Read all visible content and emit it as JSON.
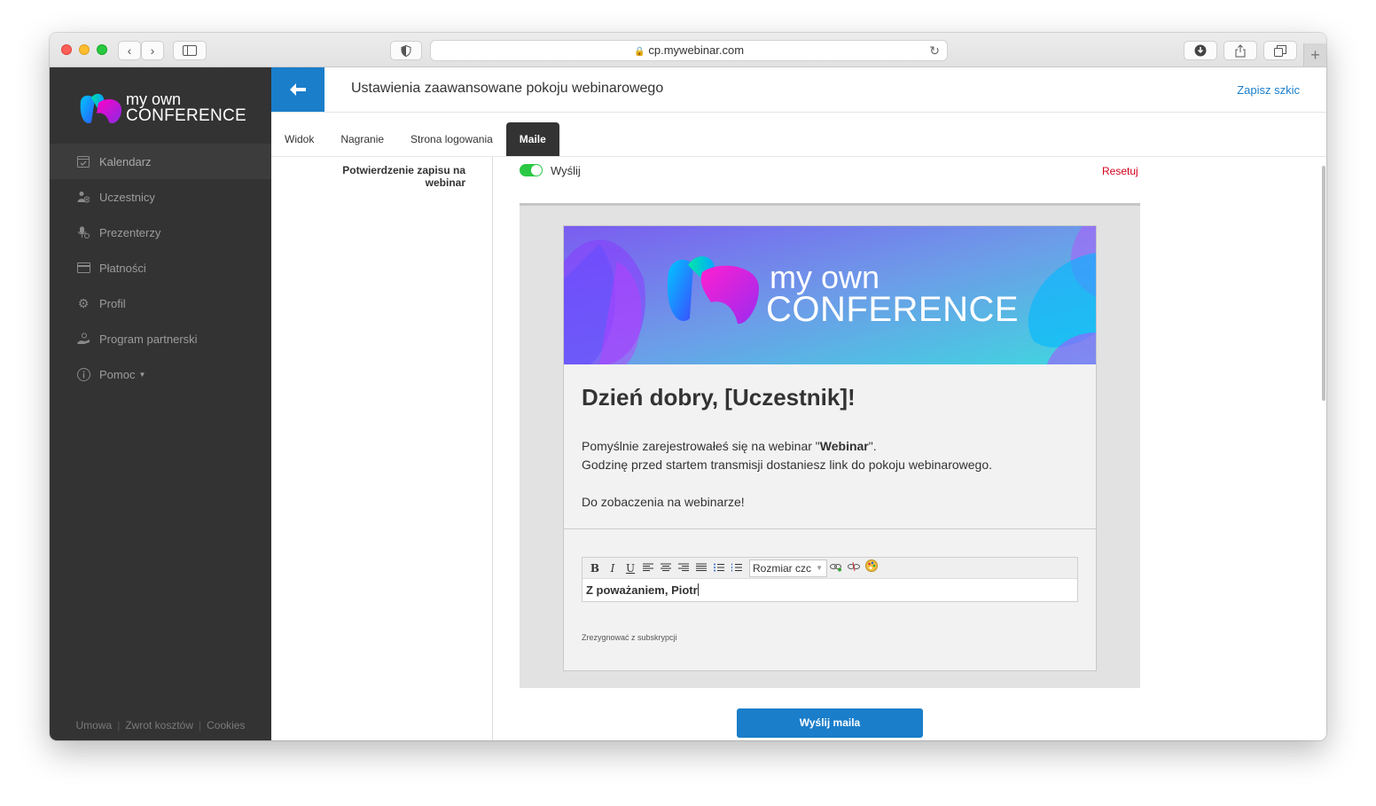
{
  "browser": {
    "url": "cp.mywebinar.com",
    "new_tab": "+"
  },
  "sidebar": {
    "logo_line1": "my own",
    "logo_line2": "CONFERENCE",
    "items": [
      {
        "label": "Kalendarz",
        "icon": "calendar-icon"
      },
      {
        "label": "Uczestnicy",
        "icon": "participants-icon"
      },
      {
        "label": "Prezenterzy",
        "icon": "presenters-icon"
      },
      {
        "label": "Płatności",
        "icon": "card-icon"
      },
      {
        "label": "Profil",
        "icon": "gear-icon"
      },
      {
        "label": "Program partnerski",
        "icon": "partner-icon"
      },
      {
        "label": "Pomoc",
        "icon": "info-icon"
      }
    ],
    "footer": [
      "Umowa",
      "Zwrot kosztów",
      "Cookies"
    ]
  },
  "header": {
    "title": "Ustawienia zaawansowane pokoju webinarowego",
    "save_draft": "Zapisz szkic"
  },
  "tabs": [
    "Widok",
    "Nagranie",
    "Strona logowania",
    "Maile"
  ],
  "active_tab": "Maile",
  "section": {
    "label": "Potwierdzenie zapisu na webinar",
    "toggle_label": "Wyślij",
    "toggle_on": true,
    "reset": "Resetuj"
  },
  "email": {
    "banner_line1": "my own",
    "banner_line2": "CONFERENCE",
    "heading": "Dzień dobry, [Uczestnik]!",
    "body_line1_prefix": "Pomyślnie zarejestrowałeś się na webinar \"",
    "body_line1_bold": "Webinar",
    "body_line1_suffix": "\".",
    "body_line2": "Godzinę przed startem transmisji dostaniesz link do pokoju webinarowego.",
    "body_line3": "Do zobaczenia na webinarze!",
    "editor_font_size_placeholder": "Rozmiar czc",
    "editor_text": "Z poważaniem, Piotr",
    "unsubscribe": "Zrezygnować z subskrypcji"
  },
  "send_button": "Wyślij maila",
  "colors": {
    "accent": "#1a7ecb",
    "sidebar_bg": "#333333",
    "toggle_on": "#2ac845",
    "reset": "#d0021b"
  }
}
